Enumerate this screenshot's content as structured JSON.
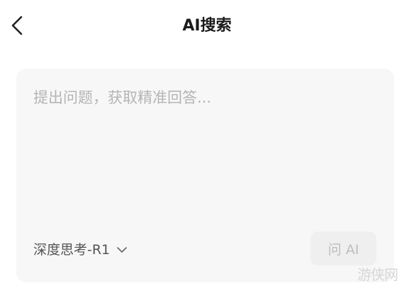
{
  "header": {
    "title": "AI搜索",
    "back_icon": "chevron-left-icon"
  },
  "search": {
    "placeholder": "提出问题，获取精准回答...",
    "value": ""
  },
  "model_selector": {
    "selected": "深度思考-R1",
    "icon": "chevron-down-icon"
  },
  "actions": {
    "ask_label": "问 AI"
  },
  "watermark": {
    "text": "游侠网"
  },
  "colors": {
    "background": "#ffffff",
    "card": "#f7f7f7",
    "placeholder": "#b4b4b4",
    "button_bg": "#efefef",
    "button_text": "#bdbdbd"
  }
}
